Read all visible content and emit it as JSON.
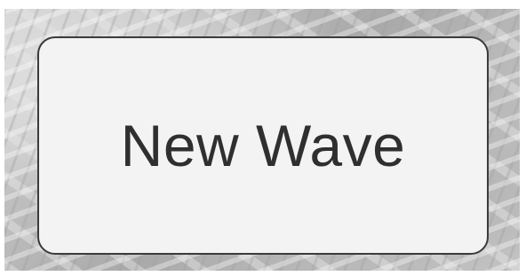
{
  "button": {
    "label": "New Wave"
  },
  "colors": {
    "button_fill": "#f3f3f3",
    "button_border": "#3b3b3b",
    "label_text": "#2f2f2f",
    "background_marble": "#c9c9c9"
  }
}
